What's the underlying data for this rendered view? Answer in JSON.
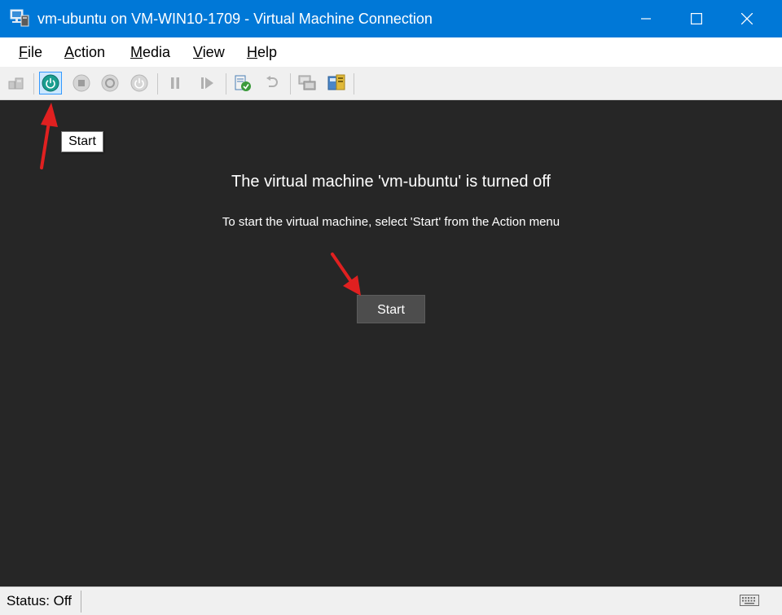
{
  "window": {
    "title": "vm-ubuntu on VM-WIN10-1709 - Virtual Machine Connection",
    "accent_color": "#0078d7",
    "controls": [
      "minimize-icon",
      "maximize-icon",
      "close-icon"
    ]
  },
  "menu": {
    "items": [
      {
        "mnemonic": "F",
        "rest": "ile"
      },
      {
        "mnemonic": "A",
        "rest": "ction"
      },
      {
        "mnemonic": "M",
        "rest": "edia"
      },
      {
        "mnemonic": "V",
        "rest": "iew"
      },
      {
        "mnemonic": "H",
        "rest": "elp"
      }
    ]
  },
  "toolbar": {
    "buttons": [
      "ctrl-alt-del-icon",
      "start-icon",
      "turn-off-icon",
      "shut-down-icon",
      "power-icon",
      "pause-icon",
      "resume-icon",
      "checkpoint-icon",
      "revert-icon",
      "enhanced-session-icon",
      "integration-icon"
    ],
    "active_button": "start-icon",
    "tooltip": "Start"
  },
  "screen": {
    "background_color": "#262626",
    "message_title": "The virtual machine 'vm-ubuntu' is turned off",
    "message_sub": "To start the virtual machine, select 'Start' from the Action menu",
    "start_button_label": "Start"
  },
  "annotations": {
    "arrow_color": "#e02020"
  },
  "status": {
    "text": "Status: Off",
    "right_icon": "keyboard-icon"
  }
}
